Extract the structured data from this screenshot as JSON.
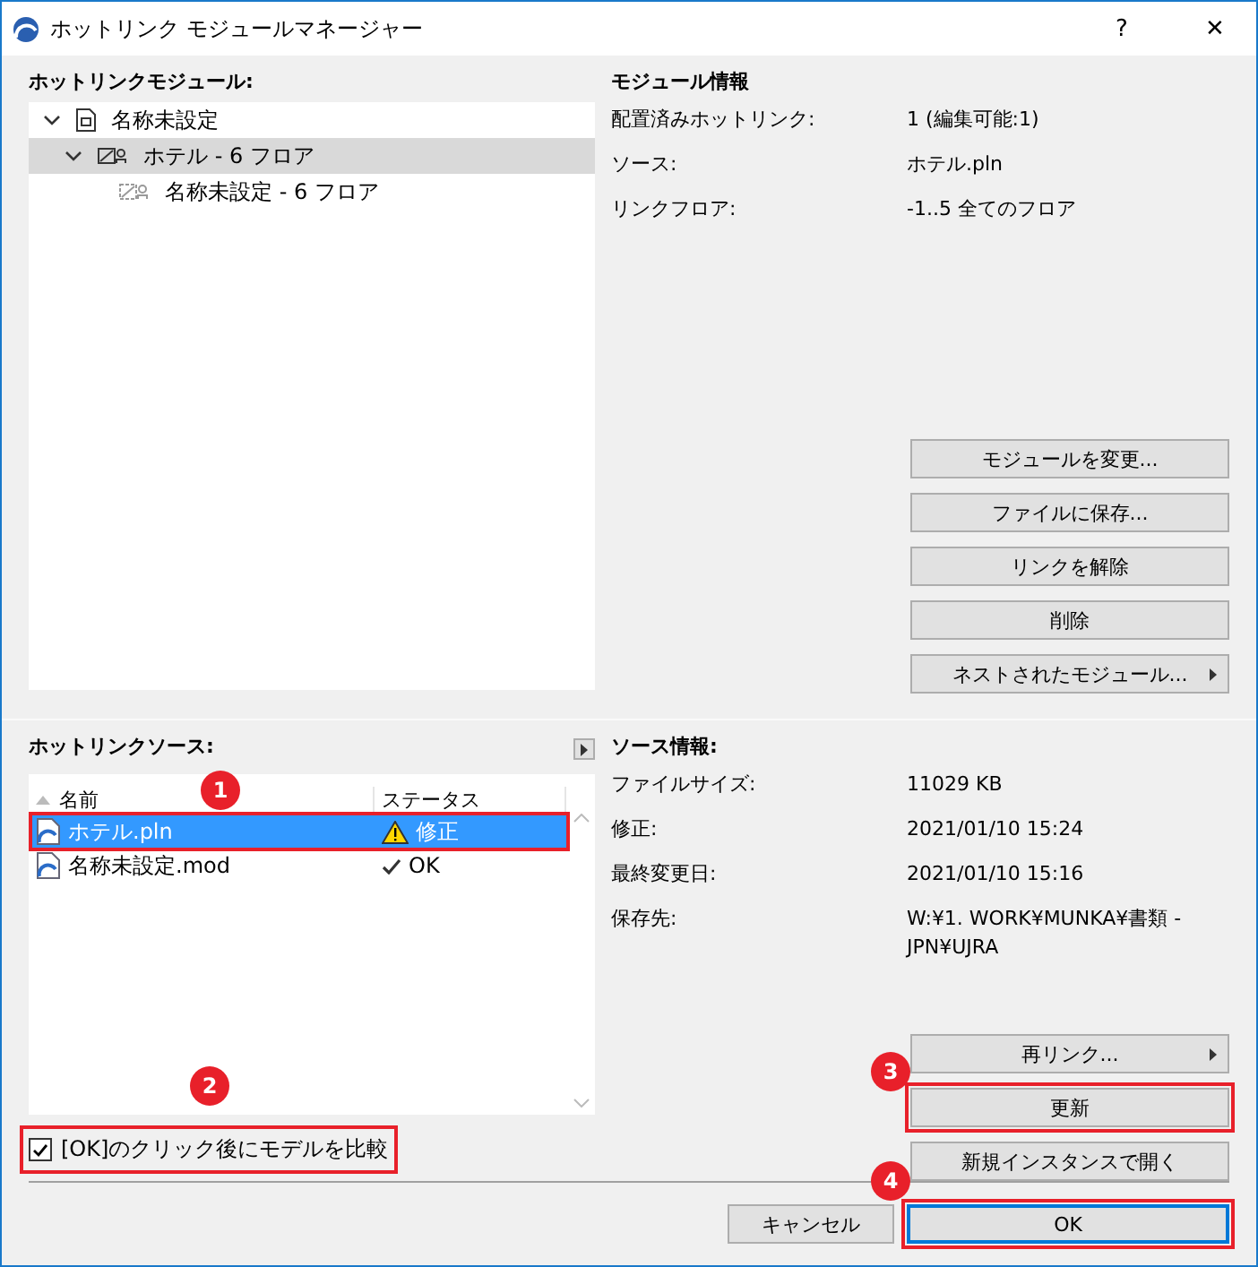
{
  "window": {
    "title": "ホットリンク モジュールマネージャー",
    "help": "?",
    "close": "✕"
  },
  "modules": {
    "label": "ホットリンクモジュール:",
    "tree": [
      {
        "label": "名称未設定",
        "kind": "file",
        "expanded": true,
        "selected": false,
        "children": [
          {
            "label": "ホテル - 6 フロア",
            "kind": "module",
            "expanded": true,
            "selected": true,
            "children": [
              {
                "label": "名称未設定 - 6 フロア",
                "kind": "placeholder",
                "selected": false
              }
            ]
          }
        ]
      }
    ]
  },
  "module_info": {
    "title": "モジュール情報",
    "rows": [
      {
        "label": "配置済みホットリンク:",
        "value": "1 (編集可能:1)"
      },
      {
        "label": "ソース:",
        "value": "ホテル.pln"
      },
      {
        "label": "リンクフロア:",
        "value": "-1..5 全てのフロア"
      }
    ],
    "buttons": [
      {
        "label": "モジュールを変更...",
        "kind": "plain"
      },
      {
        "label": "ファイルに保存...",
        "kind": "plain"
      },
      {
        "label": "リンクを解除",
        "kind": "plain"
      },
      {
        "label": "削除",
        "kind": "plain"
      },
      {
        "label": "ネストされたモジュール...",
        "kind": "submenu"
      }
    ]
  },
  "sources": {
    "label": "ホットリンクソース:",
    "columns": [
      "名前",
      "ステータス"
    ],
    "rows": [
      {
        "name": "ホテル.pln",
        "status": "修正",
        "kind": "warning",
        "selected": true,
        "highlighted": true,
        "callout": "1"
      },
      {
        "name": "名称未設定.mod",
        "status": "OK",
        "kind": "ok",
        "selected": false,
        "highlighted": false
      }
    ],
    "compare": {
      "label": "[OK]のクリック後にモデルを比較",
      "checked": true,
      "highlighted": true,
      "callout": "2"
    }
  },
  "source_info": {
    "title": "ソース情報:",
    "rows": [
      {
        "label": "ファイルサイズ:",
        "value": "11029 KB"
      },
      {
        "label": "修正:",
        "value": "2021/01/10 15:24"
      },
      {
        "label": "最終変更日:",
        "value": "2021/01/10 15:16"
      },
      {
        "label": "保存先:",
        "value": "W:¥1. WORK¥MUNKA¥書類 - JPN¥UJRA"
      }
    ],
    "buttons": [
      {
        "label": "再リンク...",
        "kind": "submenu",
        "highlighted": false
      },
      {
        "label": "更新",
        "kind": "plain",
        "highlighted": true,
        "callout": "3"
      },
      {
        "label": "新規インスタンスで開く",
        "kind": "plain",
        "highlighted": false
      }
    ]
  },
  "footer": {
    "buttons": [
      {
        "label": "キャンセル",
        "kind": "cancel",
        "highlighted": false
      },
      {
        "label": "OK",
        "kind": "default",
        "highlighted": true,
        "callout": "4"
      }
    ]
  }
}
